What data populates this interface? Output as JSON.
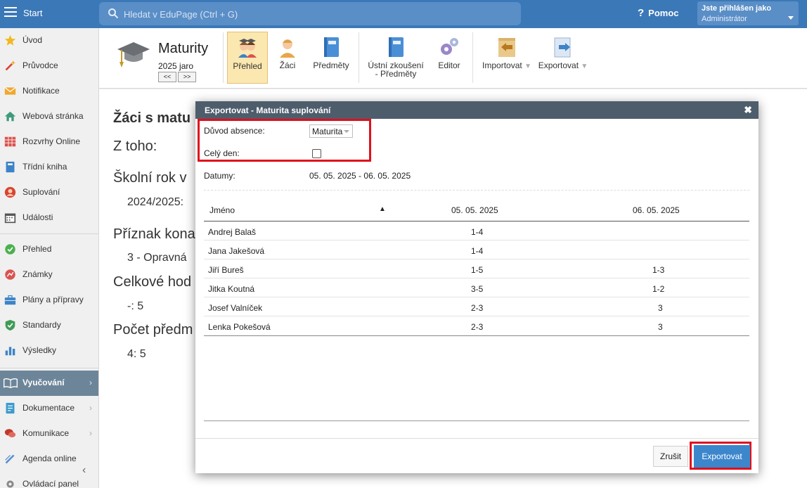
{
  "topbar": {
    "start_label": "Start",
    "search_placeholder": "Hledat v EduPage (Ctrl + G)",
    "help_label": "Pomoc",
    "user_line1": "Jste přihlášen jako",
    "user_line2": "Administrátor"
  },
  "sidebar": {
    "items": [
      {
        "label": "Úvod",
        "icon": "star-icon"
      },
      {
        "label": "Průvodce",
        "icon": "magic-wand-icon"
      },
      {
        "label": "Notifikace",
        "icon": "envelope-icon"
      },
      {
        "label": "Webová stránka",
        "icon": "house-icon"
      },
      {
        "label": "Rozvrhy Online",
        "icon": "timetable-icon"
      },
      {
        "label": "Třídní kniha",
        "icon": "notebook-icon"
      },
      {
        "label": "Suplování",
        "icon": "person-icon"
      },
      {
        "label": "Události",
        "icon": "calendar-icon"
      },
      {
        "label": "Přehled",
        "icon": "check-circle-icon"
      },
      {
        "label": "Známky",
        "icon": "grade-icon"
      },
      {
        "label": "Plány a přípravy",
        "icon": "briefcase-icon"
      },
      {
        "label": "Standardy",
        "icon": "shield-check-icon"
      },
      {
        "label": "Výsledky",
        "icon": "bar-chart-icon"
      },
      {
        "label": "Vyučování",
        "icon": "open-book-icon"
      },
      {
        "label": "Dokumentace",
        "icon": "document-icon"
      },
      {
        "label": "Komunikace",
        "icon": "chat-icon"
      },
      {
        "label": "Agenda online",
        "icon": "pencil-icon"
      },
      {
        "label": "Ovládací panel",
        "icon": "gear-icon"
      }
    ]
  },
  "module": {
    "title": "Maturity",
    "subtitle": "2025 jaro",
    "prev_label": "<<",
    "next_label": ">>"
  },
  "toolbar": {
    "prehled": "Přehled",
    "zaci": "Žáci",
    "predmety": "Předměty",
    "ustni_line1": "Ústní zkoušení",
    "ustni_line2": "- Předměty",
    "editor": "Editor",
    "importovat": "Importovat",
    "exportovat": "Exportovat",
    "caret": "▼"
  },
  "background": {
    "heading": "Žáci s matu",
    "z_toho": "Z toho:",
    "skolni_rok": "Školní rok v",
    "skolni_rok_val": "2024/2025:",
    "priznak": "Příznak kona",
    "priznak_val": "3 - Opravná",
    "celkove": "Celkové hod",
    "celkove_val": "-: 5",
    "pocet": "Počet předm",
    "pocet_val": "4: 5"
  },
  "modal": {
    "title": "Exportovat - Maturita suplování",
    "close": "✖",
    "reason_label": "Důvod absence:",
    "reason_value": "Maturita",
    "allday_label": "Celý den:",
    "dates_label": "Datumy:",
    "dates_value": "05. 05. 2025 - 06. 05. 2025",
    "table": {
      "col_name": "Jméno",
      "sort_indicator": "▲",
      "col_date1": "05. 05. 2025",
      "col_date2": "06. 05. 2025",
      "rows": [
        {
          "name": "Andrej Balaš",
          "d1": "1-4",
          "d2": ""
        },
        {
          "name": "Jana Jakešová",
          "d1": "1-4",
          "d2": ""
        },
        {
          "name": "Jiří Bureš",
          "d1": "1-5",
          "d2": "1-3"
        },
        {
          "name": "Jitka Koutná",
          "d1": "3-5",
          "d2": "1-2"
        },
        {
          "name": "Josef Valníček",
          "d1": "2-3",
          "d2": "3"
        },
        {
          "name": "Lenka Pokešová",
          "d1": "2-3",
          "d2": "3"
        }
      ]
    },
    "cancel_label": "Zrušit",
    "export_label": "Exportovat"
  },
  "colors": {
    "topbar": "#3b78b8",
    "modal_header": "#4e5d6c",
    "highlight": "#e0101c",
    "primary_button": "#3c86cc",
    "selected_tool": "#fbe7b0"
  }
}
